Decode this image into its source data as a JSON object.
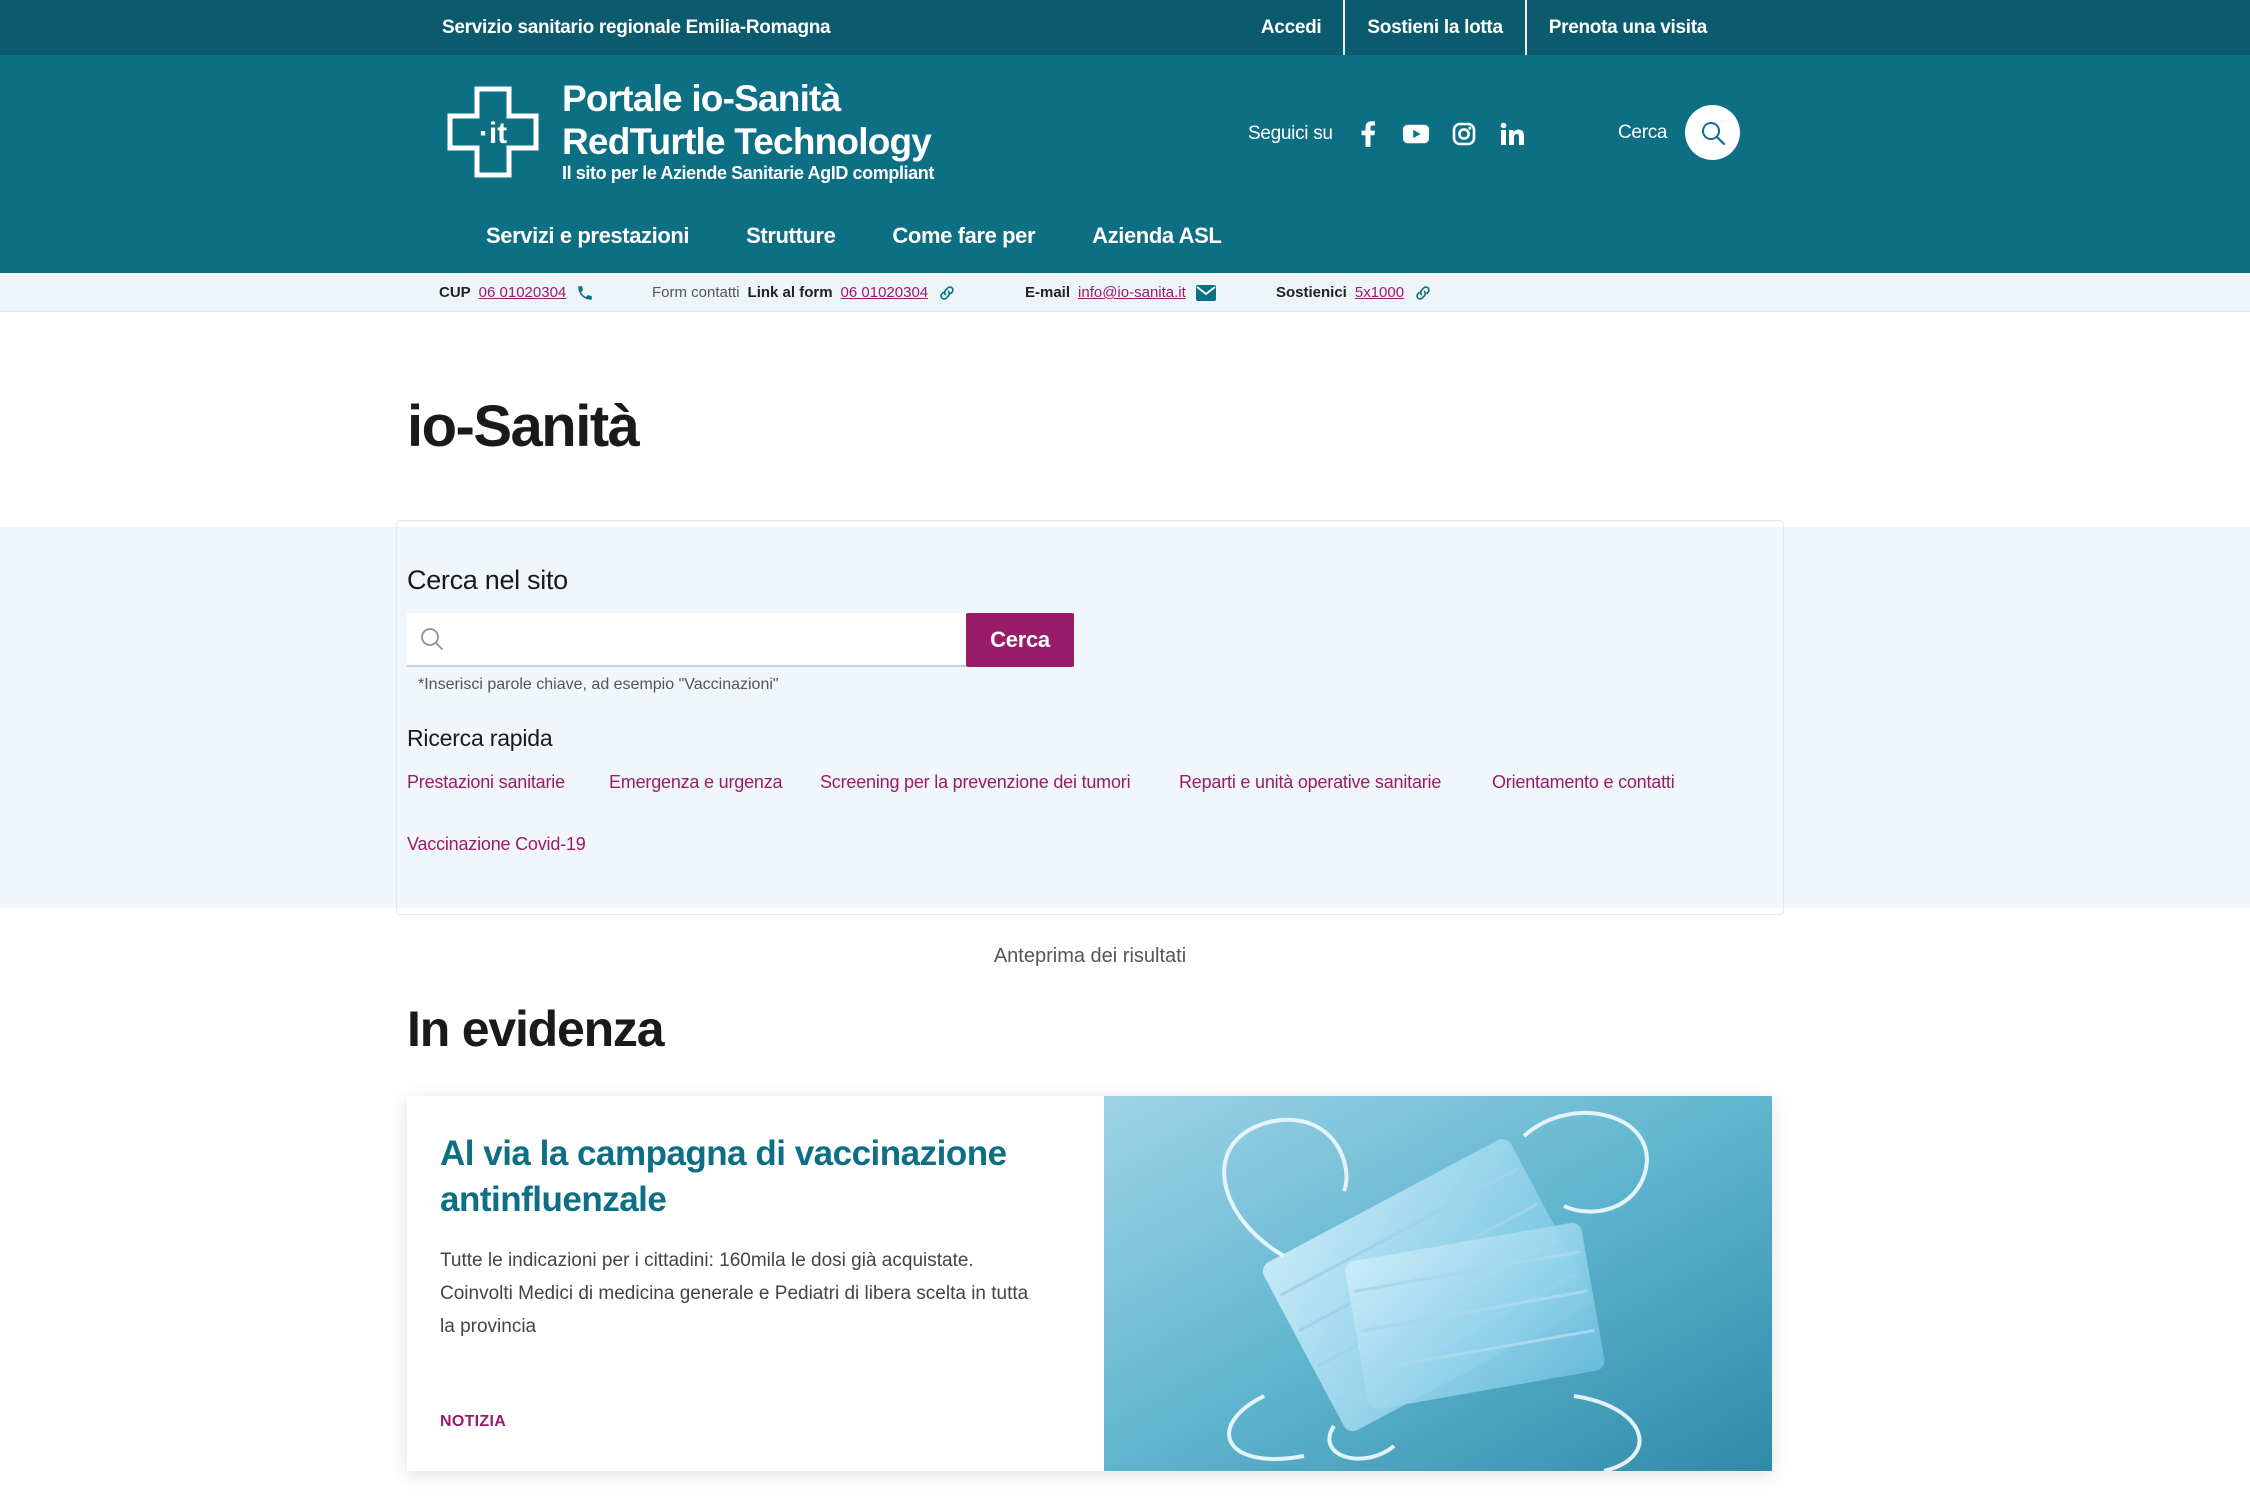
{
  "topbar": {
    "region": "Servizio sanitario regionale Emilia-Romagna",
    "links": [
      "Accedi",
      "Sostieni la lotta",
      "Prenota una visita"
    ]
  },
  "header": {
    "brand_line1": "Portale io-Sanità",
    "brand_line2": "RedTurtle Technology",
    "brand_subtitle": "Il sito per le Aziende Sanitarie AgID compliant",
    "logo_text": "·it",
    "follow_label": "Seguici su",
    "social_icons": [
      "facebook-icon",
      "youtube-icon",
      "instagram-icon",
      "linkedin-icon"
    ],
    "search_label": "Cerca",
    "nav": [
      "Servizi e prestazioni",
      "Strutture",
      "Come fare per",
      "Azienda ASL"
    ]
  },
  "contacts": {
    "cup_label": "CUP",
    "cup_value": "06 01020304",
    "form_muted": "Form contatti",
    "form_label": "Link al form",
    "form_value": "06 01020304",
    "email_label": "E-mail",
    "email_value": "info@io-sanita.it",
    "support_label": "Sostienici",
    "support_value": "5x1000"
  },
  "page": {
    "title": "io-Sanità"
  },
  "search": {
    "title": "Cerca nel sito",
    "placeholder": "",
    "button": "Cerca",
    "hint": "*Inserisci parole chiave, ad esempio \"Vaccinazioni\"",
    "quick_title": "Ricerca rapida",
    "quick_links": [
      "Prestazioni sanitarie",
      "Emergenza e urgenza",
      "Screening per la prevenzione dei tumori",
      "Reparti e unità operative sanitarie",
      "Orientamento e contatti",
      "Vaccinazione Covid-19"
    ],
    "preview": "Anteprima dei risultati"
  },
  "highlight": {
    "section_title": "In evidenza",
    "card_title": "Al via la campagna di vaccinazione antinfluenzale",
    "card_text": "Tutte le indicazioni per i cittadini: 160mila le dosi già acquistate. Coinvolti Medici di medicina generale e Pediatri di libera scelta in tutta la provincia",
    "card_tag": "NOTIZIA"
  },
  "colors": {
    "topbar": "#0b5a6e",
    "header": "#0d6f83",
    "accent": "#9a1b6a",
    "panel": "#f0f6fa"
  }
}
